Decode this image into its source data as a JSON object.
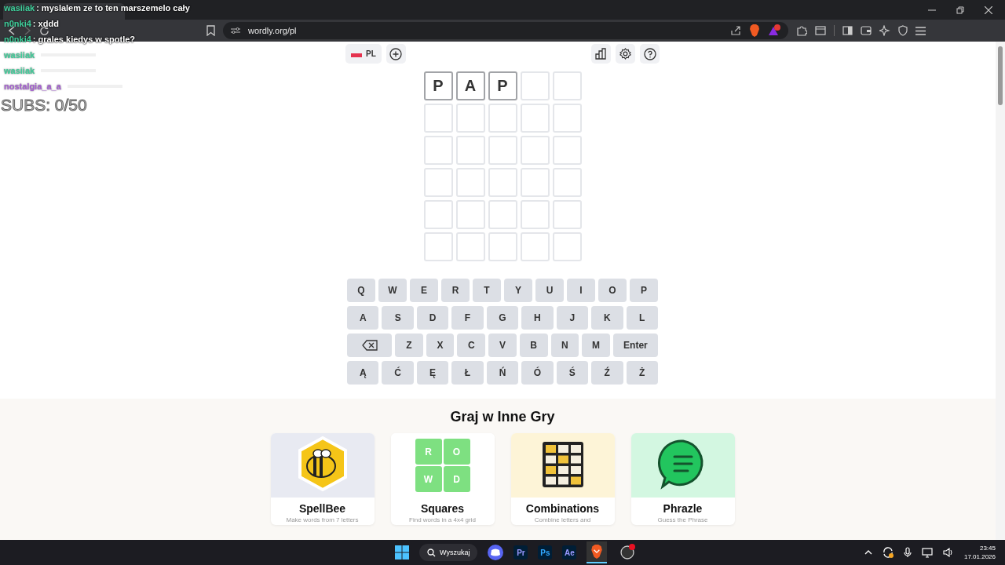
{
  "browser": {
    "url": "wordly.org/pl"
  },
  "chat_overlay": {
    "messages": [
      {
        "user": "wasiiak",
        "color": "#3fcf9b",
        "text": ": myslalem ze to ten marszemelo cały"
      },
      {
        "user": "n0nki4",
        "color": "#3fcf9b",
        "text": ": xddd"
      },
      {
        "user": "n0nki4",
        "color": "#3fcf9b",
        "text": ": grales kiedys w spotle?"
      },
      {
        "user": "wasiiak",
        "color": "#3fcf9b"
      },
      {
        "user": "wasiiak",
        "color": "#3fcf9b"
      },
      {
        "user": "nostalgia_a_a",
        "color": "#a65fd3"
      }
    ],
    "subs": "SUBS: 0/50"
  },
  "header": {
    "language": "PL"
  },
  "board": {
    "rows": [
      {
        "tiles": [
          {
            "kind": "filled",
            "letter": "P"
          },
          {
            "kind": "filled",
            "letter": "A"
          },
          {
            "kind": "filled",
            "letter": "P"
          },
          {
            "kind": "empty"
          },
          {
            "kind": "empty"
          }
        ]
      },
      {
        "tiles": [
          {
            "kind": "empty"
          },
          {
            "kind": "empty"
          },
          {
            "kind": "empty"
          },
          {
            "kind": "empty"
          },
          {
            "kind": "empty"
          }
        ]
      },
      {
        "tiles": [
          {
            "kind": "empty"
          },
          {
            "kind": "empty"
          },
          {
            "kind": "empty"
          },
          {
            "kind": "empty"
          },
          {
            "kind": "empty"
          }
        ]
      },
      {
        "tiles": [
          {
            "kind": "empty"
          },
          {
            "kind": "empty"
          },
          {
            "kind": "empty"
          },
          {
            "kind": "empty"
          },
          {
            "kind": "empty"
          }
        ]
      },
      {
        "tiles": [
          {
            "kind": "empty"
          },
          {
            "kind": "empty"
          },
          {
            "kind": "empty"
          },
          {
            "kind": "empty"
          },
          {
            "kind": "empty"
          }
        ]
      },
      {
        "tiles": [
          {
            "kind": "empty"
          },
          {
            "kind": "empty"
          },
          {
            "kind": "empty"
          },
          {
            "kind": "empty"
          },
          {
            "kind": "empty"
          }
        ]
      }
    ]
  },
  "keyboard": {
    "rows": [
      {
        "keys": [
          {
            "kind": "letter",
            "label": "Q"
          },
          {
            "kind": "letter",
            "label": "W"
          },
          {
            "kind": "letter",
            "label": "E"
          },
          {
            "kind": "letter",
            "label": "R"
          },
          {
            "kind": "letter",
            "label": "T"
          },
          {
            "kind": "letter",
            "label": "Y"
          },
          {
            "kind": "letter",
            "label": "U"
          },
          {
            "kind": "letter",
            "label": "I"
          },
          {
            "kind": "letter",
            "label": "O"
          },
          {
            "kind": "letter",
            "label": "P"
          }
        ]
      },
      {
        "keys": [
          {
            "kind": "letter",
            "label": "A"
          },
          {
            "kind": "letter",
            "label": "S"
          },
          {
            "kind": "letter",
            "label": "D"
          },
          {
            "kind": "letter",
            "label": "F"
          },
          {
            "kind": "letter",
            "label": "G"
          },
          {
            "kind": "letter",
            "label": "H"
          },
          {
            "kind": "letter",
            "label": "J"
          },
          {
            "kind": "letter",
            "label": "K"
          },
          {
            "kind": "letter",
            "label": "L"
          }
        ]
      },
      {
        "keys": [
          {
            "kind": "backspace"
          },
          {
            "kind": "letter",
            "label": "Z"
          },
          {
            "kind": "letter",
            "label": "X"
          },
          {
            "kind": "letter",
            "label": "C"
          },
          {
            "kind": "letter",
            "label": "V"
          },
          {
            "kind": "letter",
            "label": "B"
          },
          {
            "kind": "letter",
            "label": "N"
          },
          {
            "kind": "letter",
            "label": "M"
          },
          {
            "kind": "enter",
            "label": "Enter"
          }
        ]
      },
      {
        "keys": [
          {
            "kind": "letter",
            "label": "Ą"
          },
          {
            "kind": "letter",
            "label": "Ć"
          },
          {
            "kind": "letter",
            "label": "Ę"
          },
          {
            "kind": "letter",
            "label": "Ł"
          },
          {
            "kind": "letter",
            "label": "Ń"
          },
          {
            "kind": "letter",
            "label": "Ó"
          },
          {
            "kind": "letter",
            "label": "Ś"
          },
          {
            "kind": "letter",
            "label": "Ź"
          },
          {
            "kind": "letter",
            "label": "Ż"
          }
        ]
      }
    ]
  },
  "other_games": {
    "title": "Graj w Inne Gry",
    "cards": [
      {
        "kind": "spellbee",
        "name": "SpellBee",
        "description": "Make words from 7 letters"
      },
      {
        "kind": "squares",
        "name": "Squares",
        "description": "Find words in a 4x4 grid",
        "tiles": [
          "R",
          "O",
          "W",
          "D"
        ]
      },
      {
        "kind": "combinations",
        "name": "Combinations",
        "description": "Combine letters and"
      },
      {
        "kind": "phrazle",
        "name": "Phrazle",
        "description": "Guess the Phrase"
      }
    ]
  },
  "taskbar": {
    "search": "Wyszukaj",
    "apps": [
      {
        "kind": "discord"
      },
      {
        "kind": "text",
        "label": "Pr",
        "color": "#9999ff"
      },
      {
        "kind": "text",
        "label": "Ps",
        "color": "#31a8ff"
      },
      {
        "kind": "text",
        "label": "Ae",
        "color": "#9999ff"
      },
      {
        "kind": "brave",
        "selected": true
      },
      {
        "kind": "obs",
        "selected": false
      }
    ],
    "time": "23:45",
    "date": "17.01.2026"
  }
}
